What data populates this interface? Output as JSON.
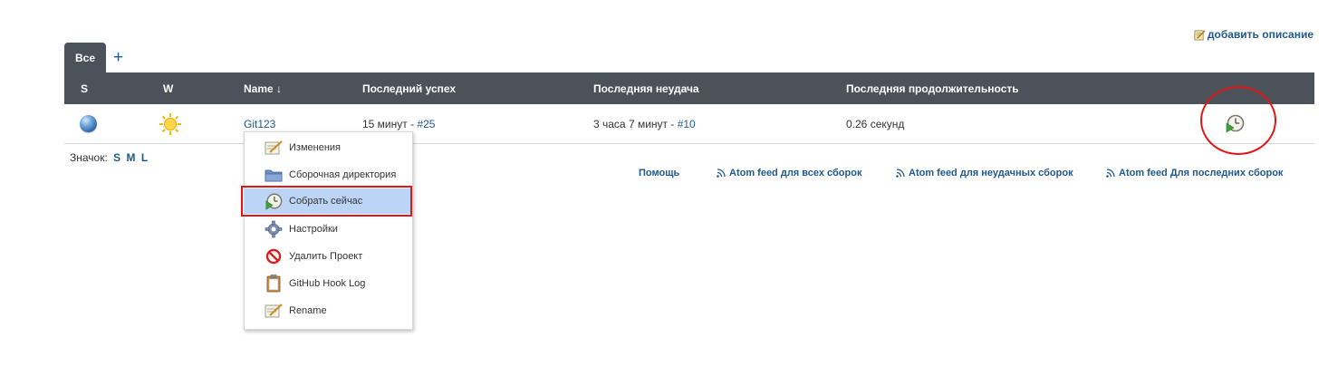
{
  "header": {
    "add_description": "добавить описание"
  },
  "tabs": {
    "active": "Все",
    "add": "+"
  },
  "table": {
    "columns": {
      "s": "S",
      "w": "W",
      "name": "Name ↓",
      "last_success": "Последний успех",
      "last_failure": "Последняя неудача",
      "last_duration": "Последняя продолжительность"
    },
    "rows": [
      {
        "name": "Git123",
        "last_success_text": "15 минут - ",
        "last_success_build": "#25",
        "last_failure_text": "3 часа 7 минут - ",
        "last_failure_build": "#10",
        "last_duration": "0.26 секунд"
      }
    ]
  },
  "icon_legend": {
    "label": "Значок:",
    "sizes": [
      "S",
      "M",
      "L"
    ]
  },
  "footer": {
    "help": "Помощь",
    "feed_all": "Atom feed для всех сборок",
    "feed_failed": "Atom feed для неудачных сборок",
    "feed_latest": "Atom feed Для последних сборок"
  },
  "context_menu": {
    "items": [
      {
        "label": "Изменения",
        "icon": "notepad-icon"
      },
      {
        "label": "Сборочная директория",
        "icon": "folder-icon"
      },
      {
        "label": "Собрать сейчас",
        "icon": "build-now-icon"
      },
      {
        "label": "Настройки",
        "icon": "gear-icon"
      },
      {
        "label": "Удалить Проект",
        "icon": "no-entry-icon"
      },
      {
        "label": "GitHub Hook Log",
        "icon": "clipboard-icon"
      },
      {
        "label": "Rename",
        "icon": "notepad-icon"
      }
    ]
  },
  "colors": {
    "header_bg": "#4b525a",
    "link": "#1f5a8d",
    "highlight": "#bcd4f6",
    "annotation_red": "#e21616"
  }
}
